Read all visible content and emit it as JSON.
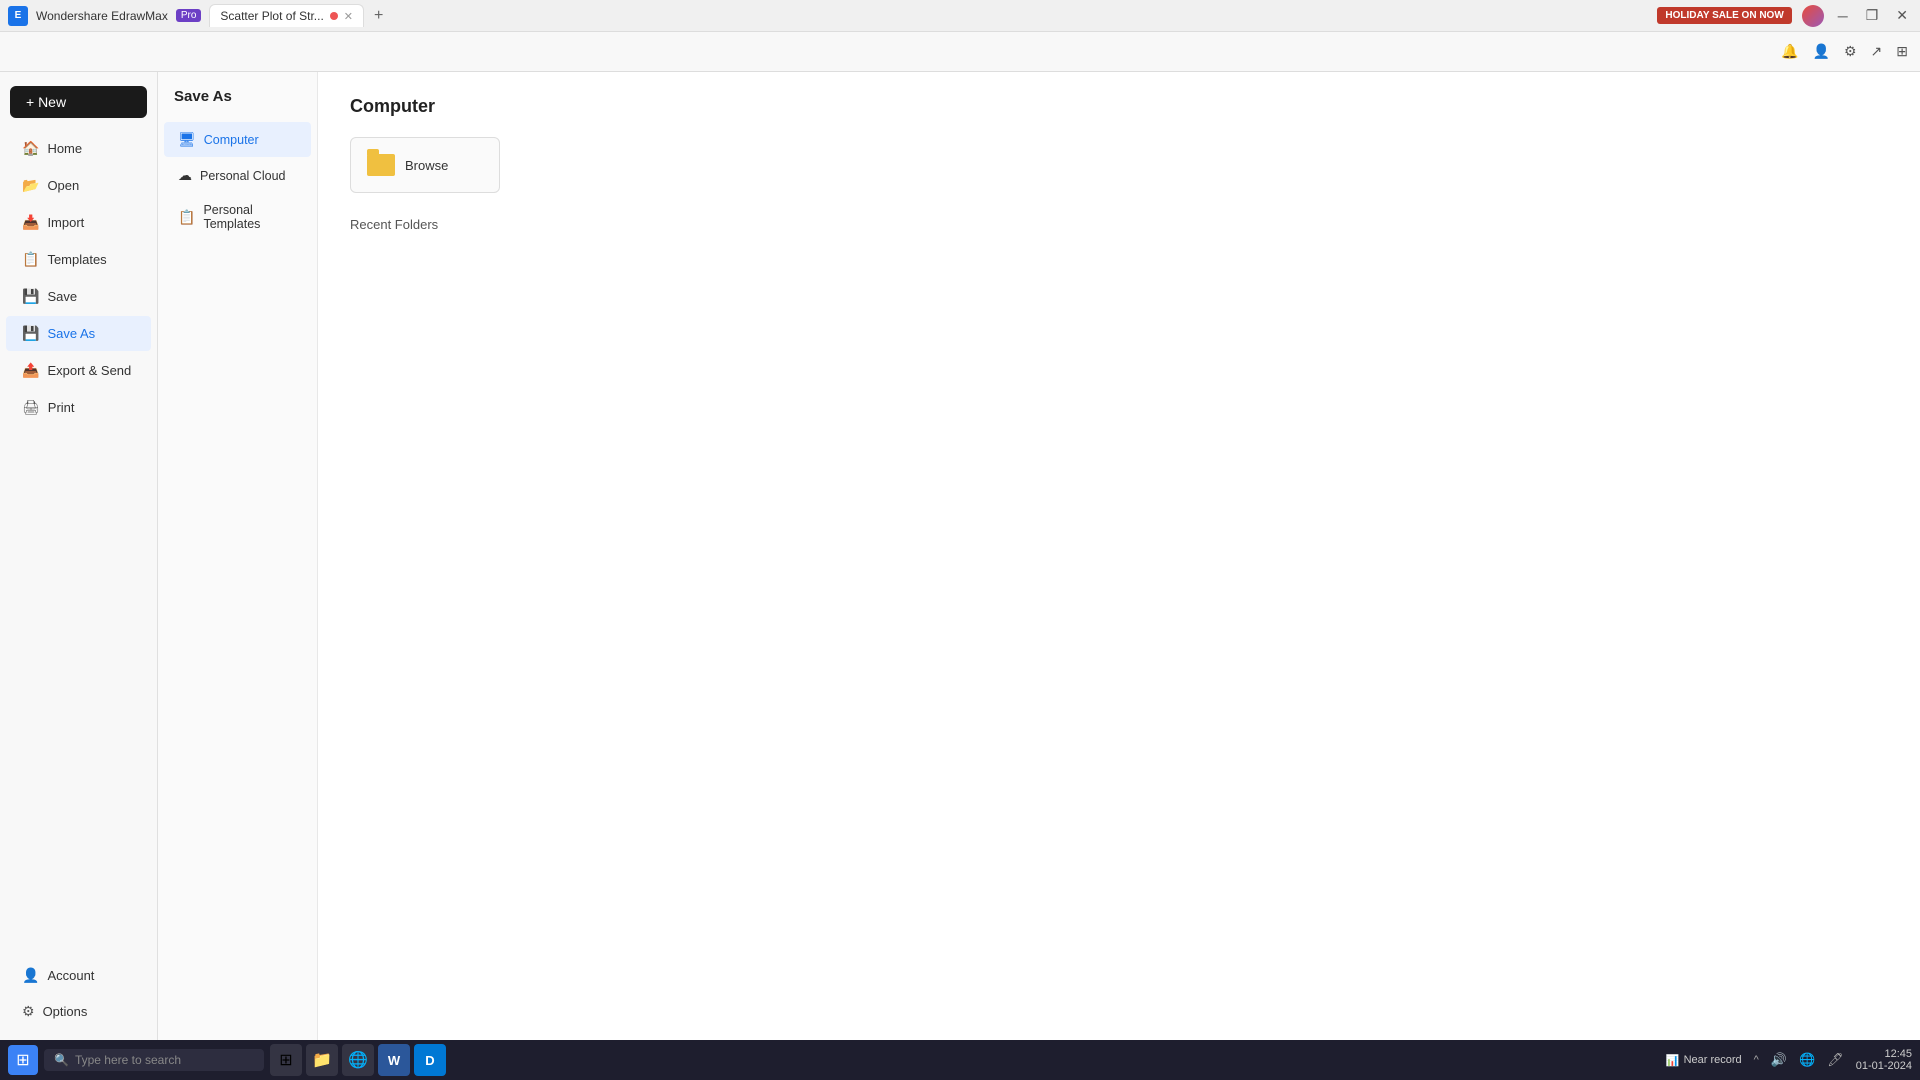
{
  "titlebar": {
    "app_name": "Wondershare EdrawMax",
    "pro_label": "Pro",
    "tab_title": "Scatter Plot of Str...",
    "tab_modified": true,
    "add_tab_label": "+",
    "holiday_badge": "HOLIDAY SALE ON NOW",
    "minimize_icon": "─",
    "restore_icon": "❐",
    "close_icon": "✕"
  },
  "toolbar": {
    "bell_icon": "🔔",
    "user_icon": "👤",
    "settings_icon": "⚙",
    "share_icon": "↗",
    "view_icon": "⊞"
  },
  "sidebar": {
    "new_button": "+ New",
    "items": [
      {
        "id": "home",
        "label": "Home",
        "icon": "🏠"
      },
      {
        "id": "open",
        "label": "Open",
        "icon": "📂"
      },
      {
        "id": "import",
        "label": "Import",
        "icon": "📥"
      },
      {
        "id": "templates",
        "label": "Templates",
        "icon": "📋"
      },
      {
        "id": "save",
        "label": "Save",
        "icon": "💾"
      },
      {
        "id": "save-as",
        "label": "Save As",
        "icon": "💾",
        "active": true
      },
      {
        "id": "export-send",
        "label": "Export & Send",
        "icon": "📤"
      },
      {
        "id": "print",
        "label": "Print",
        "icon": "🖨"
      }
    ],
    "bottom_items": [
      {
        "id": "account",
        "label": "Account",
        "icon": "👤"
      },
      {
        "id": "options",
        "label": "Options",
        "icon": "⚙"
      }
    ]
  },
  "second_panel": {
    "title": "Save As",
    "items": [
      {
        "id": "computer",
        "label": "Computer",
        "icon": "🖥",
        "active": true
      },
      {
        "id": "personal-cloud",
        "label": "Personal Cloud",
        "icon": "☁"
      },
      {
        "id": "personal-templates",
        "label": "Personal Templates",
        "icon": "📋"
      }
    ]
  },
  "main_panel": {
    "title": "Computer",
    "browse_label": "Browse",
    "recent_folders_label": "Recent Folders"
  },
  "taskbar": {
    "start_icon": "⊞",
    "search_placeholder": "Type here to search",
    "apps": [
      {
        "id": "task-view",
        "icon": "⊞",
        "color": "#666"
      },
      {
        "id": "file-explorer",
        "icon": "📁",
        "color": "#f0a500"
      },
      {
        "id": "chrome",
        "icon": "🌐",
        "color": "#4285f4"
      },
      {
        "id": "word",
        "icon": "W",
        "color": "#2b579a"
      },
      {
        "id": "app5",
        "icon": "D",
        "color": "#0078d4"
      }
    ],
    "near_record_label": "Near record",
    "weather_icon": "📊",
    "time": "12:45",
    "date": "01-01-2024",
    "sys_icons": [
      "^",
      "🔊",
      "🌐",
      "🖊"
    ]
  }
}
